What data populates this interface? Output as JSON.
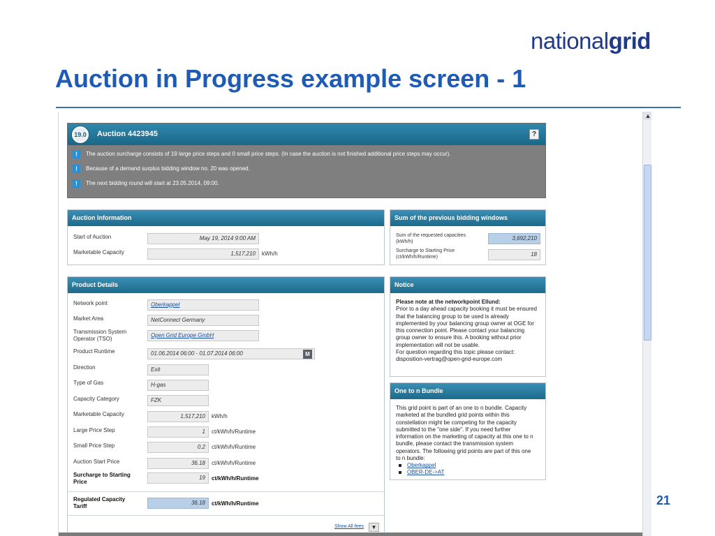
{
  "slide": {
    "logo_regular": "national",
    "logo_bold": "grid",
    "title": "Auction in Progress example screen - 1",
    "page_number": "21"
  },
  "auction": {
    "round_badge": "19.0",
    "title": "Auction 4423945",
    "help": "?",
    "warning_glyph": "!",
    "messages": [
      "The auction surcharge consists of 19 large price steps and 0 small price steps. (In case the auction is not finished additional price steps may occur).",
      "Because of a demand surplus bidding window no. 20 was opened.",
      "The next bidding round will start at 23.05.2014, 09:00."
    ]
  },
  "auction_information": {
    "header": "Auction Information",
    "start_label": "Start of Auction",
    "start_value": "May 19, 2014 9:00 AM",
    "capacity_label": "Marketable Capacity",
    "capacity_value": "1,517,210",
    "capacity_unit": "kWh/h"
  },
  "previous_windows": {
    "header": "Sum of the previous bidding windows",
    "requested_label_1": "Sum of the requested capacities",
    "requested_label_2": "(kWh/h)",
    "requested_value": "3,692,210",
    "surcharge_label_1": "Surcharge to Starting Price",
    "surcharge_label_2": "(ct/kWh/h/Runtime)",
    "surcharge_value": "18"
  },
  "product_details": {
    "header": "Product Details",
    "network_point_label": "Network point",
    "network_point_value": "Oberkappel",
    "market_area_label": "Market Area",
    "market_area_value": "NetConnect Germany",
    "tso_label_1": "Transmission System",
    "tso_label_2": "Operator (TSO)",
    "tso_value": "Open Grid Europe GmbH",
    "runtime_label": "Product Runtime",
    "runtime_value": "01.06.2014 06:00 - 01.07.2014 06:00",
    "runtime_button": "M",
    "direction_label": "Direction",
    "direction_value": "Exit",
    "gas_label": "Type of Gas",
    "gas_value": "H-gas",
    "category_label": "Capacity Category",
    "category_value": "FZK",
    "marketable_label": "Marketable Capacity",
    "marketable_value": "1,517,210",
    "marketable_unit": "kWh/h",
    "large_step_label": "Large Price Step",
    "large_step_value": "1",
    "large_step_unit": "ct/kWh/h/Runtime",
    "small_step_label": "Small Price Step",
    "small_step_value": "0.2",
    "small_step_unit": "ct/kWh/h/Runtime",
    "start_price_label": "Auction Start Price",
    "start_price_value": "36.18",
    "start_price_unit": "ct/kWh/h/Runtime",
    "surcharge_label_1": "Surcharge to Starting",
    "surcharge_label_2": "Price",
    "surcharge_value": "19",
    "surcharge_unit": "ct/kWh/h/Runtime",
    "tariff_label_1": "Regulated Capacity",
    "tariff_label_2": "Tariff",
    "tariff_value": "36.18",
    "tariff_unit": "ct/kWh/h/Runtime",
    "show_fees": "Show All fees",
    "fees_toggle": "▼"
  },
  "notice": {
    "header": "Notice",
    "heading": "Please note at the networkpoint Ellund:",
    "lines": [
      "Prior to a day ahead capacity booking it must be ensured",
      "that the balancing group to be used is already",
      "implemented by your balancing group owner at OGE for",
      "this connection point. Please contact your balancing",
      "group owner to ensure this. A booking without prior",
      "implementation will not be usable.",
      "For question regarding this topic please contact:",
      "disposition-vertrag@open-grid-europe.com"
    ]
  },
  "bundle": {
    "header": "One to n Bundle",
    "lines": [
      "This grid point is part of an one to n bundle. Capacity",
      "marketed at the bundled grid points within this",
      "constellation might be competing for the capacity",
      "submitted to the \"one side\". If you need further",
      "information on the marketing of capacity at this one to n",
      "bundle, please contact the transmission system",
      "operators. The following grid points are part of this one",
      "to n bundle:"
    ],
    "points": [
      "Oberkappel",
      "OBER-DE->AT"
    ]
  },
  "scrollbar": {
    "up_arrow": "▲"
  }
}
